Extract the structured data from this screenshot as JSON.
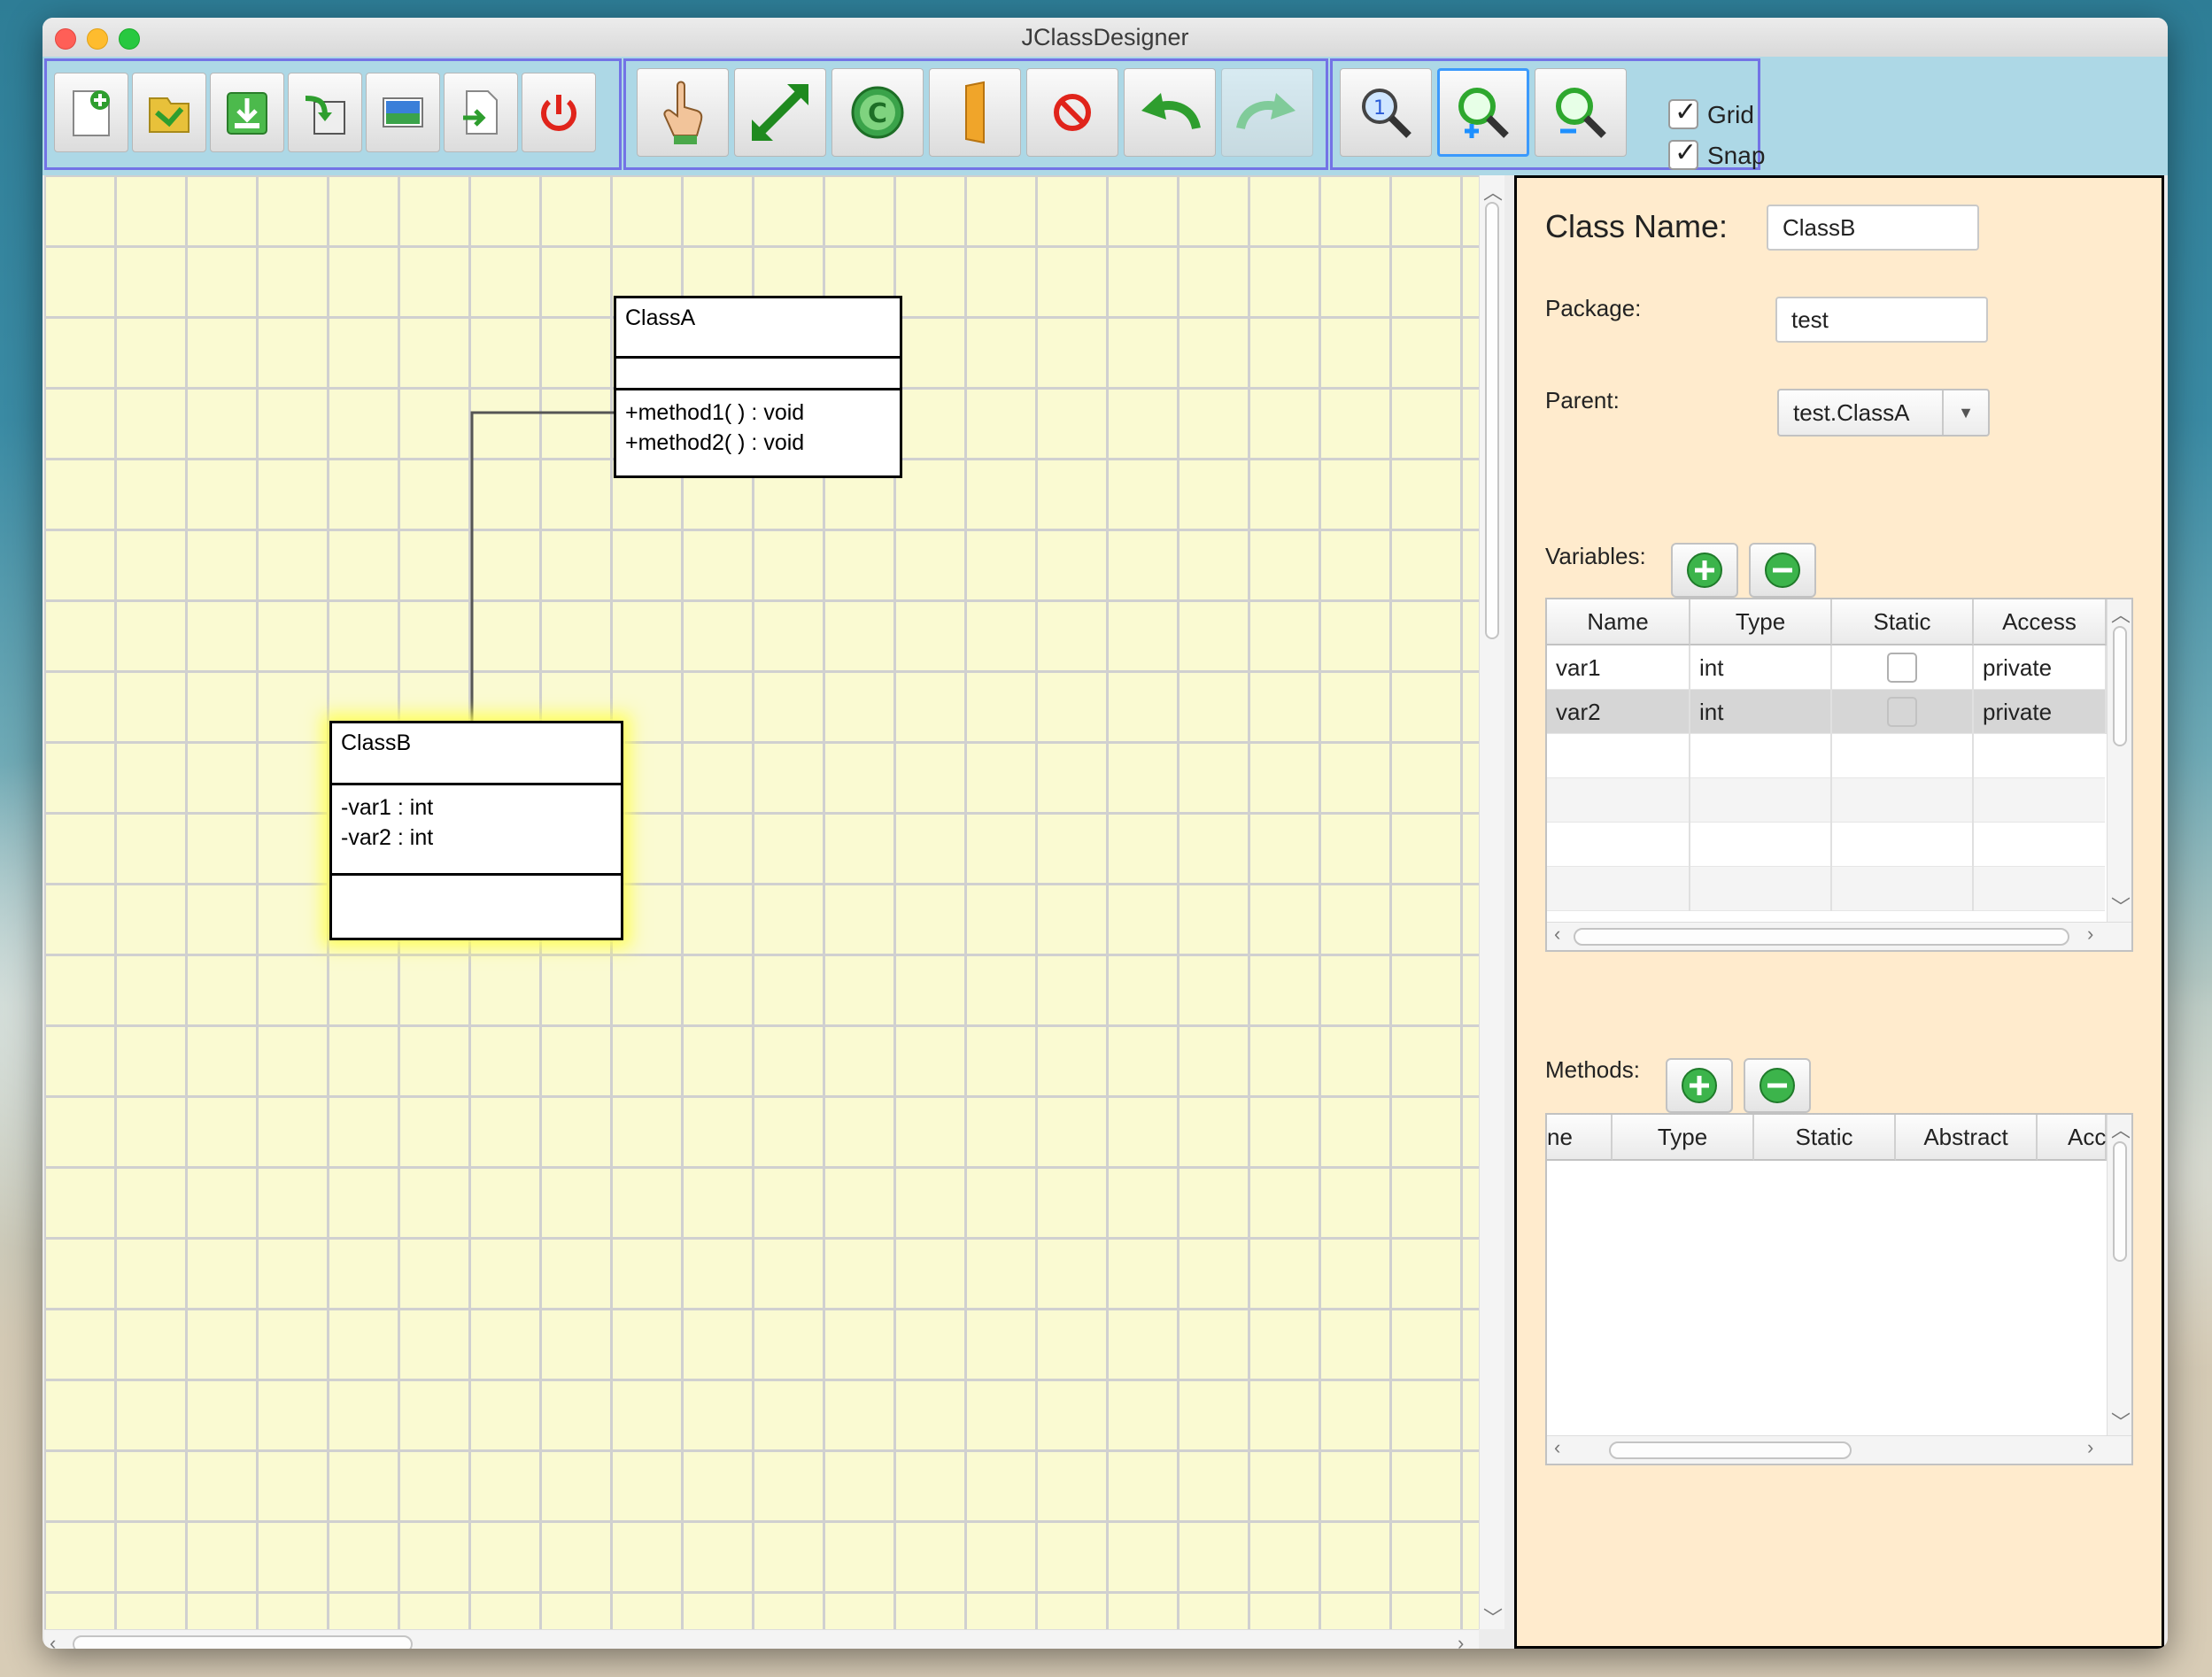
{
  "window": {
    "title": "JClassDesigner"
  },
  "toolbar": {
    "file_buttons": [
      "new-file",
      "open-folder",
      "save",
      "save-as",
      "export-image",
      "export-code",
      "exit"
    ],
    "edit_buttons": [
      "select-hand",
      "resize",
      "add-class",
      "add-interface",
      "remove",
      "undo",
      "redo"
    ],
    "view_buttons": [
      "zoom-reset",
      "zoom-in",
      "zoom-out"
    ],
    "grid_label": "Grid",
    "grid_checked": true,
    "snap_label": "Snap",
    "snap_checked": true
  },
  "diagram": {
    "classA": {
      "name": "ClassA",
      "variables": [],
      "methods": [
        "+method1( ) : void",
        "+method2( ) : void"
      ]
    },
    "classB": {
      "name": "ClassB",
      "variables": [
        "-var1 : int",
        "-var2 : int"
      ],
      "methods": []
    }
  },
  "panel": {
    "class_name_label": "Class Name:",
    "class_name_value": "ClassB",
    "package_label": "Package:",
    "package_value": "test",
    "parent_label": "Parent:",
    "parent_value": "test.ClassA",
    "variables_label": "Variables:",
    "variables_table": {
      "columns": [
        "Name",
        "Type",
        "Static",
        "Access"
      ],
      "rows": [
        {
          "name": "var1",
          "type": "int",
          "static": false,
          "access": "private"
        },
        {
          "name": "var2",
          "type": "int",
          "static": false,
          "access": "private"
        }
      ]
    },
    "methods_label": "Methods:",
    "methods_table": {
      "columns": [
        "ne",
        "Type",
        "Static",
        "Abstract",
        "Acc"
      ],
      "rows": []
    }
  },
  "colors": {
    "toolbar_bg": "#add8e6",
    "canvas_bg": "#fafad2",
    "panel_bg": "#ffebcd",
    "group_border": "#7373e6"
  }
}
